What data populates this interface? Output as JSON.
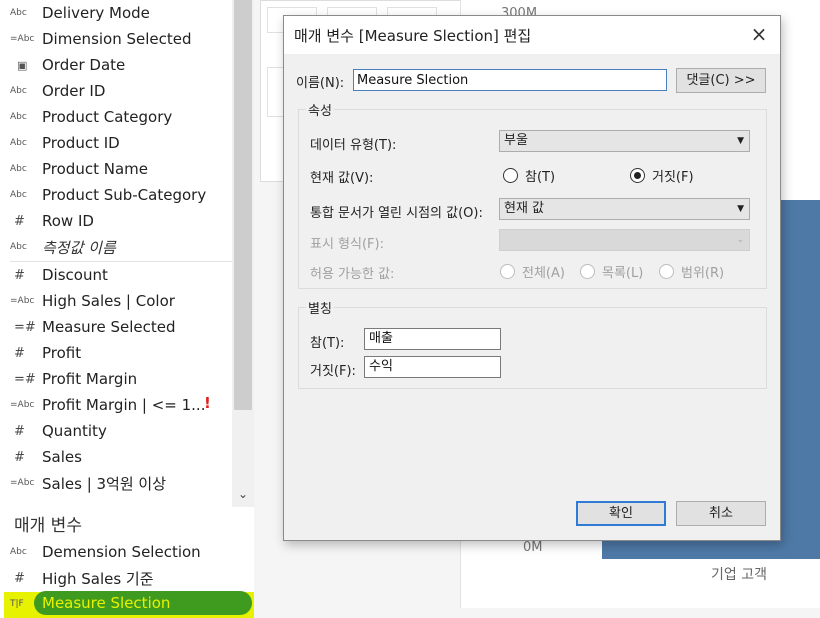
{
  "data_pane": {
    "fields": [
      {
        "icon": "Abc",
        "label": "Delivery Mode"
      },
      {
        "icon": "=Abc",
        "label": "Dimension Selected"
      },
      {
        "icon": "calendar",
        "label": "Order Date"
      },
      {
        "icon": "Abc",
        "label": "Order ID"
      },
      {
        "icon": "Abc",
        "label": "Product Category"
      },
      {
        "icon": "Abc",
        "label": "Product ID"
      },
      {
        "icon": "Abc",
        "label": "Product Name"
      },
      {
        "icon": "Abc",
        "label": "Product Sub-Category"
      },
      {
        "icon": "#",
        "label": "Row ID"
      },
      {
        "icon": "Abc",
        "label": "측정값 이름"
      },
      {
        "icon": "#",
        "label": "Discount"
      },
      {
        "icon": "=Abc",
        "label": "High Sales | Color"
      },
      {
        "icon": "=#",
        "label": "Measure Selected"
      },
      {
        "icon": "#",
        "label": "Profit"
      },
      {
        "icon": "=#",
        "label": "Profit Margin"
      },
      {
        "icon": "=Abc",
        "label": "Profit Margin | <= 1...",
        "warning": "!"
      },
      {
        "icon": "#",
        "label": "Quantity"
      },
      {
        "icon": "#",
        "label": "Sales"
      },
      {
        "icon": "=Abc",
        "label": "Sales | 3억원 이상"
      }
    ],
    "params_header": "매개 변수",
    "params": [
      {
        "icon": "Abc",
        "label": "Demension Selection"
      },
      {
        "icon": "#",
        "label": "High Sales 기준"
      },
      {
        "icon": "T|F",
        "label": "Measure Slection",
        "selected": true
      }
    ]
  },
  "sheet": {
    "axis_top": "300M",
    "axis_bottom": "0M",
    "category": "기업 고객",
    "bar_color": "#4e79a7"
  },
  "dialog": {
    "title": "매개 변수 [Measure Slection] 편집",
    "close_icon": "×",
    "name_label": "이름(N):",
    "name_value": "Measure Slection",
    "comment_button": "댓글(C) >>",
    "properties_title": "속성",
    "data_type_label": "데이터 유형(T):",
    "data_type_value": "부울",
    "current_value_label": "현재 값(V):",
    "radio_true": "참(T)",
    "radio_false": "거짓(F)",
    "current_value_selected": "false",
    "open_value_label": "통합 문서가 열린 시점의 값(O):",
    "open_value_value": "현재 값",
    "display_format_label": "표시 형식(F):",
    "allowed_values_label": "허용 가능한 값:",
    "allowed_all": "전체(A)",
    "allowed_list": "목록(L)",
    "allowed_range": "범위(R)",
    "aliases_title": "별칭",
    "alias_true_label": "참(T):",
    "alias_true_value": "매출",
    "alias_false_label": "거짓(F):",
    "alias_false_value": "수익",
    "ok_button": "확인",
    "cancel_button": "취소"
  },
  "colors": {
    "highlight": "#e6f200",
    "selection_pill": "#3f9a20",
    "focus_border": "#2f7bd6"
  }
}
